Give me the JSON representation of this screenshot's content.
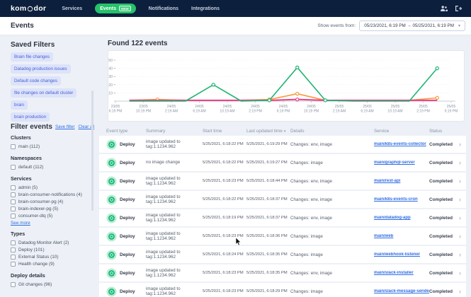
{
  "nav": {
    "logo": "komodor",
    "items": [
      {
        "label": "Services",
        "active": false
      },
      {
        "label": "Events",
        "active": true,
        "badge": "NEW"
      },
      {
        "label": "Notifications",
        "active": false
      },
      {
        "label": "Integrations",
        "active": false
      }
    ]
  },
  "page_header": {
    "title": "Events",
    "show_events_label": "Show events from:",
    "date_range": "05/23/2021, 6:19 PM → 05/25/2021, 6:19 PM"
  },
  "icons": {
    "dropdown": "▾",
    "sort": "▾",
    "row_chevron": "›"
  },
  "sidebar": {
    "saved_filters_title": "Saved Filters",
    "saved_filters": [
      "Brain file changes",
      "Datadog production issues",
      "Default code changes",
      "file changes on default cluster",
      "brain",
      "brain production"
    ],
    "filter_events_title": "Filter events",
    "save_filter_label": "Save filter",
    "clear_all_label": "Clear all",
    "groups": [
      {
        "title": "Clusters",
        "items": [
          "main (112)"
        ]
      },
      {
        "title": "Namespaces",
        "items": [
          "default (112)"
        ]
      },
      {
        "title": "Services",
        "items": [
          "admin (5)",
          "brain-consumer-notifications (4)",
          "brain-consumer-pg (4)",
          "brain-indexer-pg (5)",
          "consumer-dlq (5)"
        ],
        "more_label": "See more"
      },
      {
        "title": "Types",
        "items": [
          "Datadog Monitor Alert (2)",
          "Deploy (101)",
          "External Status (10)",
          "Health change (9)"
        ]
      },
      {
        "title": "Deploy details",
        "items": [
          "Git changes (96)"
        ]
      }
    ]
  },
  "main": {
    "found_title": "Found 122 events"
  },
  "chart_data": {
    "type": "line",
    "title": "Found 122 events",
    "ylim": [
      0,
      50
    ],
    "yticks": [
      10,
      20,
      30,
      40,
      50
    ],
    "grid": "dotted-horizontal",
    "legend": "none",
    "x_tick_labels": [
      [
        "23/05",
        "6:19 PM"
      ],
      [
        "23/05",
        "10:19 PM"
      ],
      [
        "24/05",
        "2:19 AM"
      ],
      [
        "24/05",
        "6:19 AM"
      ],
      [
        "24/05",
        "10:19 AM"
      ],
      [
        "24/05",
        "2:19 PM"
      ],
      [
        "24/05",
        "6:19 PM"
      ],
      [
        "24/05",
        "10:19 PM"
      ],
      [
        "25/05",
        "2:19 AM"
      ],
      [
        "25/05",
        "6:19 AM"
      ],
      [
        "25/05",
        "10:19 AM"
      ],
      [
        "25/05",
        "2:19 PM"
      ],
      [
        "25/05",
        "6:19 PM"
      ]
    ],
    "points_between_ticks": true,
    "series": [
      {
        "name": "series-orange",
        "color": "#f79b3f",
        "values": [
          1,
          2,
          1,
          1,
          1,
          2,
          9,
          1,
          1,
          1,
          1,
          4
        ],
        "markers": [
          1,
          5,
          6,
          11
        ]
      },
      {
        "name": "series-pink",
        "color": "#ee3f86",
        "values": [
          1,
          1,
          1,
          1,
          1,
          1,
          2,
          1,
          1,
          1,
          1,
          1
        ],
        "markers": [
          6
        ]
      },
      {
        "name": "series-green",
        "color": "#1fb574",
        "values": [
          0,
          0,
          0,
          20,
          0,
          1,
          41,
          1,
          0,
          0,
          0,
          40
        ],
        "markers": [
          3,
          5,
          6,
          7,
          11
        ]
      }
    ]
  },
  "table": {
    "columns": [
      "Event type",
      "Summary",
      "Start time",
      "Last updated time",
      "Details",
      "Service",
      "Status"
    ],
    "sorted_column_index": 3,
    "rows": [
      {
        "type": "Deploy",
        "summary": "image updated to tag:1.1234.962",
        "start": "5/25/2021, 6:18:22 PM",
        "updated": "5/25/2021, 6:19:29 PM",
        "details": "Changes: env, image",
        "service": "main/k8s-events-collector",
        "status": "Completed"
      },
      {
        "type": "Deploy",
        "summary": "no image change",
        "start": "5/25/2021, 6:18:22 PM",
        "updated": "5/25/2021, 6:19:27 PM",
        "details": "Changes: image",
        "service": "main/graphql-server",
        "status": "Completed"
      },
      {
        "type": "Deploy",
        "summary": "image updated to tag:1.1234.962",
        "start": "5/25/2021, 6:18:23 PM",
        "updated": "5/25/2021, 6:18:44 PM",
        "details": "Changes: env, image",
        "service": "main/rest-api",
        "status": "Completed"
      },
      {
        "type": "Deploy",
        "summary": "image updated to tag:1.1234.962",
        "start": "5/25/2021, 6:18:22 PM",
        "updated": "5/25/2021, 6:18:37 PM",
        "details": "Changes: env, image",
        "service": "main/k8s-events-cron",
        "status": "Completed"
      },
      {
        "type": "Deploy",
        "summary": "image updated to tag:1.1234.962",
        "start": "5/25/2021, 6:18:19 PM",
        "updated": "5/25/2021, 6:18:37 PM",
        "details": "Changes: env, image",
        "service": "main/datadog-app",
        "status": "Completed"
      },
      {
        "type": "Deploy",
        "summary": "image updated to tag:1.1234.962",
        "start": "5/25/2021, 6:18:23 PM",
        "updated": "5/25/2021, 6:18:36 PM",
        "details": "Changes: image",
        "service": "main/web",
        "status": "Completed"
      },
      {
        "type": "Deploy",
        "summary": "image updated to tag:1.1234.962",
        "start": "5/25/2021, 6:18:24 PM",
        "updated": "5/25/2021, 6:18:35 PM",
        "details": "Changes: image",
        "service": "main/webhook-listener",
        "status": "Completed"
      },
      {
        "type": "Deploy",
        "summary": "image updated to tag:1.1234.962",
        "start": "5/25/2021, 6:18:23 PM",
        "updated": "5/25/2021, 6:18:35 PM",
        "details": "Changes: env, image",
        "service": "main/slack-installer",
        "status": "Completed"
      },
      {
        "type": "Deploy",
        "summary": "image updated to tag:1.1234.962",
        "start": "5/25/2021, 6:18:23 PM",
        "updated": "5/25/2021, 6:18:29 PM",
        "details": "Changes: image",
        "service": "main/slack-message-sender",
        "status": "Completed"
      }
    ]
  },
  "colors": {
    "navbar_bg": "#0c1f3c",
    "accent_green": "#25c269",
    "chip_bg": "#dde3f9",
    "chip_text": "#4560d8",
    "link_blue": "#2d6ce5",
    "page_bg": "#edf1f7",
    "deploy_icon_outer": "#b9edd5",
    "deploy_icon_inner": "#17b877"
  }
}
